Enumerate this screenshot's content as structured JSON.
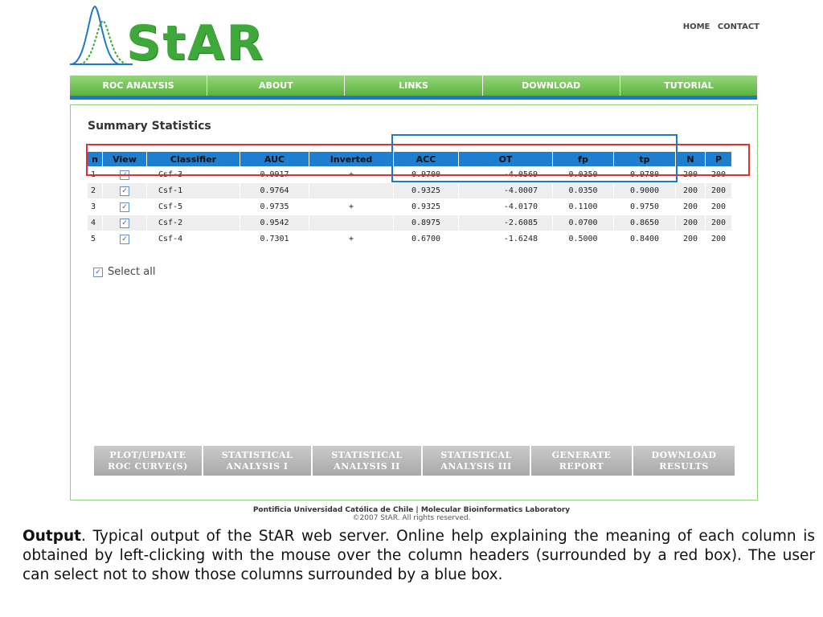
{
  "header": {
    "logo_text": "StAR",
    "links": [
      "HOME",
      "CONTACT"
    ],
    "colors": {
      "green": "#3fa83a",
      "blue": "#1e78c8"
    }
  },
  "nav": [
    "ROC ANALYSIS",
    "ABOUT",
    "LINKS",
    "DOWNLOAD",
    "TUTORIAL"
  ],
  "panel": {
    "title": "Summary Statistics",
    "columns": [
      "n",
      "View",
      "Classifier",
      "AUC",
      "Inverted",
      "ACC",
      "OT",
      "fp",
      "tp",
      "N",
      "P"
    ],
    "rows": [
      {
        "n": "1",
        "view": "checked",
        "classifier": "Csf-3",
        "auc": "0.9917",
        "inverted": "+",
        "acc": "0.9700",
        "ot": "-4.0569",
        "fp": "0.0350",
        "tp": "0.9780",
        "N": "200",
        "P": "200"
      },
      {
        "n": "2",
        "view": "checked",
        "classifier": "Csf-1",
        "auc": "0.9764",
        "inverted": "",
        "acc": "0.9325",
        "ot": "-4.0007",
        "fp": "0.0350",
        "tp": "0.9000",
        "N": "200",
        "P": "200"
      },
      {
        "n": "3",
        "view": "checked",
        "classifier": "Csf-5",
        "auc": "0.9735",
        "inverted": "+",
        "acc": "0.9325",
        "ot": "-4.0170",
        "fp": "0.1100",
        "tp": "0.9750",
        "N": "200",
        "P": "200"
      },
      {
        "n": "4",
        "view": "checked",
        "classifier": "Csf-2",
        "auc": "0.9542",
        "inverted": "",
        "acc": "0.8975",
        "ot": "-2.6085",
        "fp": "0.0700",
        "tp": "0.8650",
        "N": "200",
        "P": "200"
      },
      {
        "n": "5",
        "view": "checked",
        "classifier": "Csf-4",
        "auc": "0.7301",
        "inverted": "+",
        "acc": "0.6700",
        "ot": "-1.6248",
        "fp": "0.5000",
        "tp": "0.8400",
        "N": "200",
        "P": "200"
      }
    ],
    "select_all": "Select all",
    "buttons": [
      {
        "line1": "PLOT/UPDATE",
        "line2": "ROC CURVE(S)"
      },
      {
        "line1": "STATISTICAL",
        "line2": "ANALYSIS I"
      },
      {
        "line1": "STATISTICAL",
        "line2": "ANALYSIS II"
      },
      {
        "line1": "STATISTICAL",
        "line2": "ANALYSIS III"
      },
      {
        "line1": "GENERATE",
        "line2": "REPORT"
      },
      {
        "line1": "DOWNLOAD",
        "line2": "RESULTS"
      }
    ]
  },
  "footer": {
    "line1": "Pontificia Universidad Católica de Chile  |  Molecular Bioinformatics Laboratory",
    "line2": "©2007 StAR. All rights reserved."
  },
  "caption": {
    "bold": "Output",
    "text": ". Typical output of the StAR web server. Online help explaining the  meaning of each column is obtained by left-clicking with the mouse over the column headers (surrounded by a red box). The user can select not to show those columns surrounded by a blue box."
  }
}
